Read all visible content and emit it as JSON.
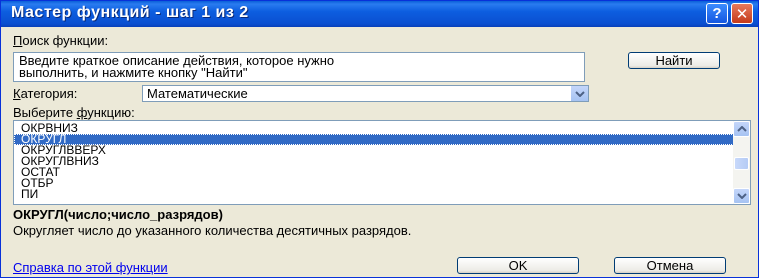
{
  "window": {
    "title": "Мастер функций - шаг 1 из 2",
    "help_glyph": "?",
    "close_glyph": "✕"
  },
  "search": {
    "label_first": "П",
    "label_rest": "оиск функции:",
    "description_line1": "Введите краткое описание действия, которое нужно",
    "description_line2": "выполнить, и нажмите кнопку \"Найти\"",
    "find_button": "Найти"
  },
  "category": {
    "label_first": "К",
    "label_rest": "атегория:",
    "selected": "Математические"
  },
  "select_function": {
    "label_pre": "Выберите ",
    "label_underlined": "ф",
    "label_post": "ункцию:"
  },
  "functions": [
    "ОКРВНИЗ",
    "ОКРУГЛ",
    "ОКРУГЛВВЕРХ",
    "ОКРУГЛВНИЗ",
    "ОСТАТ",
    "ОТБР",
    "ПИ"
  ],
  "selected_index": 1,
  "signature": "ОКРУГЛ(число;число_разрядов)",
  "signature_description": "Округляет число до указанного количества десятичных разрядов.",
  "help_link": "Справка по этой функции",
  "buttons": {
    "ok": "OK",
    "cancel": "Отмена"
  }
}
